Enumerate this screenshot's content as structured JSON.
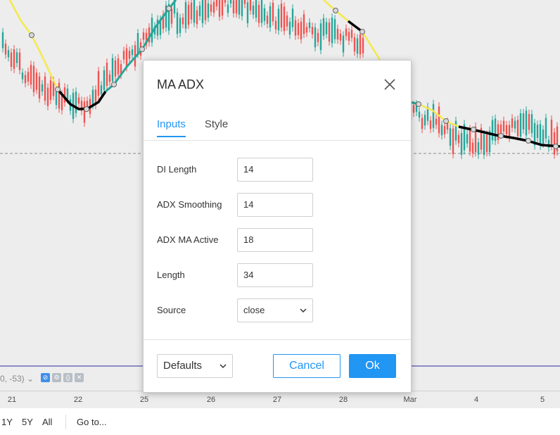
{
  "dialog": {
    "title": "MA ADX",
    "tabs": [
      {
        "label": "Inputs",
        "active": true
      },
      {
        "label": "Style",
        "active": false
      }
    ],
    "fields": [
      {
        "label": "DI Length",
        "value": "14"
      },
      {
        "label": "ADX Smoothing",
        "value": "14"
      },
      {
        "label": "ADX MA Active",
        "value": "18"
      },
      {
        "label": "Length",
        "value": "34"
      }
    ],
    "source": {
      "label": "Source",
      "value": "close"
    },
    "defaults_label": "Defaults",
    "cancel_label": "Cancel",
    "ok_label": "Ok"
  },
  "indicator_status": "0, -53)",
  "time_axis": {
    "ticks": [
      "21",
      "22",
      "25",
      "26",
      "27",
      "28",
      "Mar",
      "4",
      "5"
    ]
  },
  "range_bar": {
    "buttons": [
      "1Y",
      "5Y",
      "All"
    ],
    "goto_label": "Go to..."
  },
  "colors": {
    "accent": "#2196f3",
    "ma_yellow": "#f5e94a",
    "ma_teal": "#26a69a",
    "ma_black": "#000000",
    "candle_up": "#26a69a",
    "candle_down": "#ef5350"
  }
}
